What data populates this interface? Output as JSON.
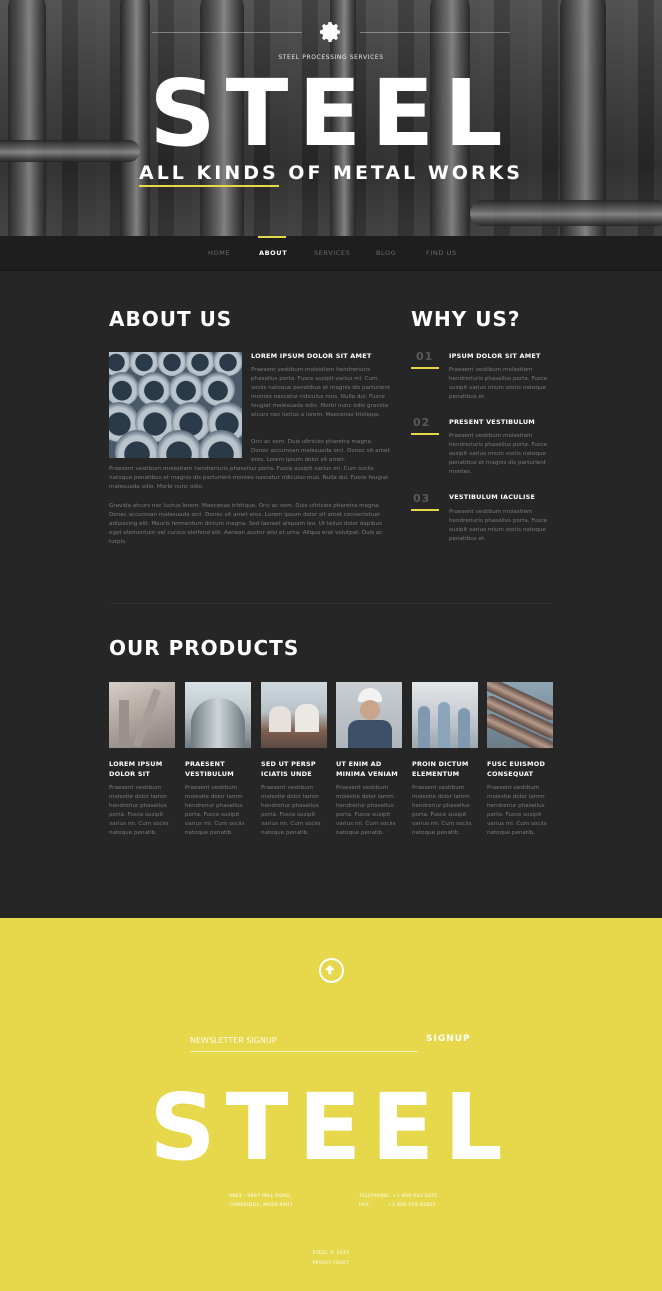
{
  "hero": {
    "tagline": "STEEL PROCESSING SERVICES",
    "title": "STEEL",
    "subtitle_underlined": "ALL KINDS",
    "subtitle_rest": " OF METAL WORKS"
  },
  "nav": {
    "items": [
      {
        "label": "HOME"
      },
      {
        "label": "ABOUT"
      },
      {
        "label": "SERVICES"
      },
      {
        "label": "BLOG"
      },
      {
        "label": "FIND US"
      }
    ],
    "active_color": "#e6d84a"
  },
  "about": {
    "heading": "ABOUT US",
    "subheading": "LOREM IPSUM DOLOR SIT AMET",
    "para_side": "Praesent vestibum molestiem hendreriuris phasellus porta. Fusce susipit varius mi. Cum sociis natoque penatibus et magnis dis parturient montes nascetur ridiculus mus. Nulla dui. Fusce feugiat malesuada odio. Morbi nunc odio gravida atcurs nec luctus a lorem. Maecenas tristique.",
    "para_side2": "Orci ac sem. Duis ultricies pharetra magna. Donec accumsan malesuada orci. Donec sit amet eros. Lorem ipsum dolor sit amet.",
    "para_full": "Praesent vestibum molestiem hendreriuris phasellus porta. Fusce susipit varius mi. Cum sociis natoque penatibus et magnis dis parturient montes nascetur ridiculus mus. Nulla dui. Fusce feugiat malesuada odio. Morbi nunc odio.",
    "para_full2": "Gravida atcurs nec luctus lorem. Maecenas tristique. Orci ac sem. Duis ultricies pharetra magna. Donec accumsan malesuada orci. Donec sit amet eros. Lorem ipsum dolor sit amet consectetuer adipiscing elit. Mauris fermentum dictum magna. Sed laoreet aliquam leo. Ut tellus dolor dapibus eget elementum vel cursus eleifend elit. Aenean auctor wisi et urna. Aliqua erat volutpat. Duis ac turpis."
  },
  "why": {
    "heading": "WHY US?",
    "items": [
      {
        "num": "01",
        "title": "IPSUM DOLOR SIT AMET",
        "text": "Praesent vestibum molestiem hendreriuris phasellus porta. Fusce susipit varius mium sociis natoque penatibus et."
      },
      {
        "num": "02",
        "title": "PRESENT VESTIBULUM",
        "text": "Praesent vestibum molestiem hendreriuris phasellus porta. Fusce susipit varius mium sociis natoque penatibus et magnis dis parturient montes."
      },
      {
        "num": "03",
        "title": "VESTIBULUM IACULISE",
        "text": "Praesent vestibum molestiem hendreriuris phasellus porta. Fusce susipit varius mium sociis natoque penatibus et."
      }
    ]
  },
  "products": {
    "heading": "OUR PRODUCTS",
    "items": [
      {
        "title1": "LOREM IPSUM",
        "title2": "DOLOR SIT",
        "text": "Praesent vestibum molestie dolor lamm hendreriur phasellus porta. Fusce susipit varius mi. Cum sociis natoque penatib."
      },
      {
        "title1": "PRAESENT",
        "title2": "VESTIBULUM",
        "text": "Praesent vestibum molestie dolor lamm hendreriur phasellus porta. Fusce susipit varius mi. Cum sociis natoque penatib."
      },
      {
        "title1": "SED UT PERSP",
        "title2": "ICIATIS UNDE",
        "text": "Praesent vestibum molestie dolor lamm hendreriur phasellus porta. Fusce susipit varius mi. Cum sociis natoque penatib."
      },
      {
        "title1": "UT ENIM AD",
        "title2": "MINIMA VENIAM",
        "text": "Praesent vestibum molestie dolor lamm hendreriur phasellus porta. Fusce susipit varius mi. Cum sociis natoque penatib."
      },
      {
        "title1": "PROIN DICTUM",
        "title2": "ELEMENTUM",
        "text": "Praesent vestibum molestie dolor lamm hendreriur phasellus porta. Fusce susipit varius mi. Cum sociis natoque penatib."
      },
      {
        "title1": "FUSC EUISMOD",
        "title2": "CONSEQUAT",
        "text": "Praesent vestibum molestie dolor lamm hendreriur phasellus porta. Fusce susipit varius mi. Cum sociis natoque penatib."
      }
    ]
  },
  "footer": {
    "newsletter_placeholder": "NEWSLETTER SIGNUP",
    "signup_label": "SIGNUP",
    "logo": "STEEL",
    "address1": "9863 - 9867 MILL ROAD,",
    "address2": "CAMBRIDGE, MG09 99HT",
    "phone": "TELEPHONE: +1 800 603 6035",
    "fax": "FAX:          +1 800 559 6580Y",
    "copyright": "STEEL © 2015",
    "privacy": "PRIVACY POLICY",
    "bg_color": "#e6d84a"
  }
}
